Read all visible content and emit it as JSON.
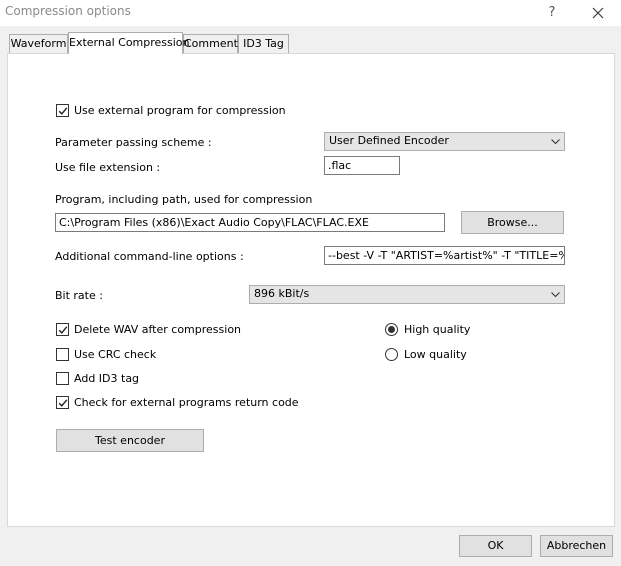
{
  "window": {
    "title": "Compression options",
    "help_glyph": "?"
  },
  "tabs": [
    {
      "label": "Waveform"
    },
    {
      "label": "External Compression"
    },
    {
      "label": "Comment"
    },
    {
      "label": "ID3 Tag"
    }
  ],
  "external": {
    "use_external_label": "Use external program for compression",
    "use_external_checked": true,
    "param_scheme_label": "Parameter passing scheme :",
    "param_scheme_value": "User Defined Encoder",
    "file_ext_label": "Use file extension :",
    "file_ext_value": ".flac",
    "program_label": "Program, including path, used for compression",
    "program_value": "C:\\Program Files (x86)\\Exact Audio Copy\\FLAC\\FLAC.EXE",
    "browse_label": "Browse...",
    "cmdline_label": "Additional command-line options :",
    "cmdline_value": "--best -V -T \"ARTIST=%artist%\" -T \"TITLE=%title%\"",
    "bitrate_label": "Bit rate :",
    "bitrate_value": "896 kBit/s",
    "options": [
      {
        "label": "Delete WAV after compression",
        "checked": true
      },
      {
        "label": "Use CRC check",
        "checked": false
      },
      {
        "label": "Add ID3 tag",
        "checked": false
      },
      {
        "label": "Check for external programs return code",
        "checked": true
      }
    ],
    "quality": [
      {
        "label": "High quality",
        "selected": true
      },
      {
        "label": "Low quality",
        "selected": false
      }
    ],
    "test_encoder_label": "Test encoder"
  },
  "footer": {
    "ok_label": "OK",
    "cancel_label": "Abbrechen"
  }
}
